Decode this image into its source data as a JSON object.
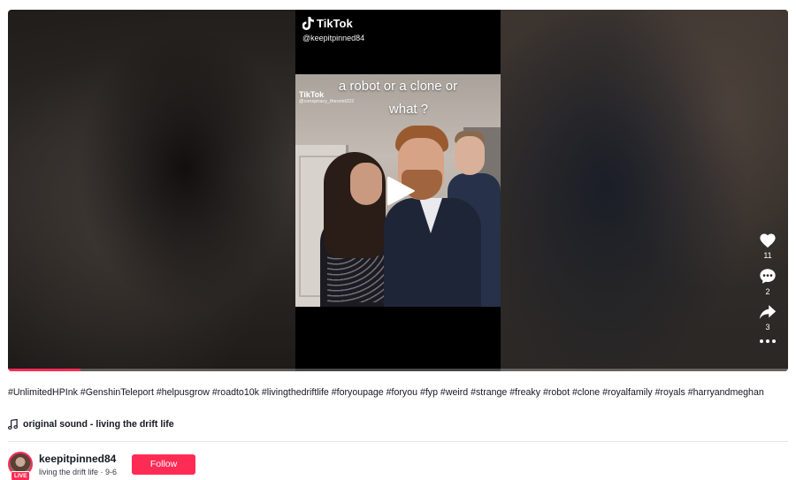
{
  "video": {
    "watermark_brand": "TikTok",
    "watermark_handle": "@keepitpinned84",
    "caption_line1": "a robot or a clone or",
    "caption_line2": "what ?",
    "inner_watermark_brand": "TikTok",
    "inner_watermark_handle": "@conspiracy_theorist222",
    "progress": 0.093,
    "play_icon": "play-icon"
  },
  "actions": {
    "likes": "11",
    "comments": "2",
    "shares": "3",
    "like_icon": "heart-icon",
    "comment_icon": "comment-icon",
    "share_icon": "share-icon",
    "more_icon": "more-dots-icon"
  },
  "description": {
    "hashtags": [
      "#UnlimitedHPInk",
      "#GenshinTeleport",
      "#helpusgrow",
      "#roadto10k",
      "#livingthedriftlife",
      "#foryoupage",
      "#foryou",
      "#fyp",
      "#weird",
      "#strange",
      "#freaky",
      "#robot",
      "#clone",
      "#royalfamily",
      "#royals",
      "#harryandmeghan"
    ]
  },
  "sound": {
    "icon": "music-note-icon",
    "label": "original sound - living the drift life"
  },
  "author": {
    "username": "keepitpinned84",
    "subtitle": "living the drift life · 9-6",
    "live_badge": "LIVE",
    "follow_label": "Follow"
  },
  "colors": {
    "accent": "#fe2c55",
    "text": "#161823",
    "divider": "#e6e6e8"
  }
}
